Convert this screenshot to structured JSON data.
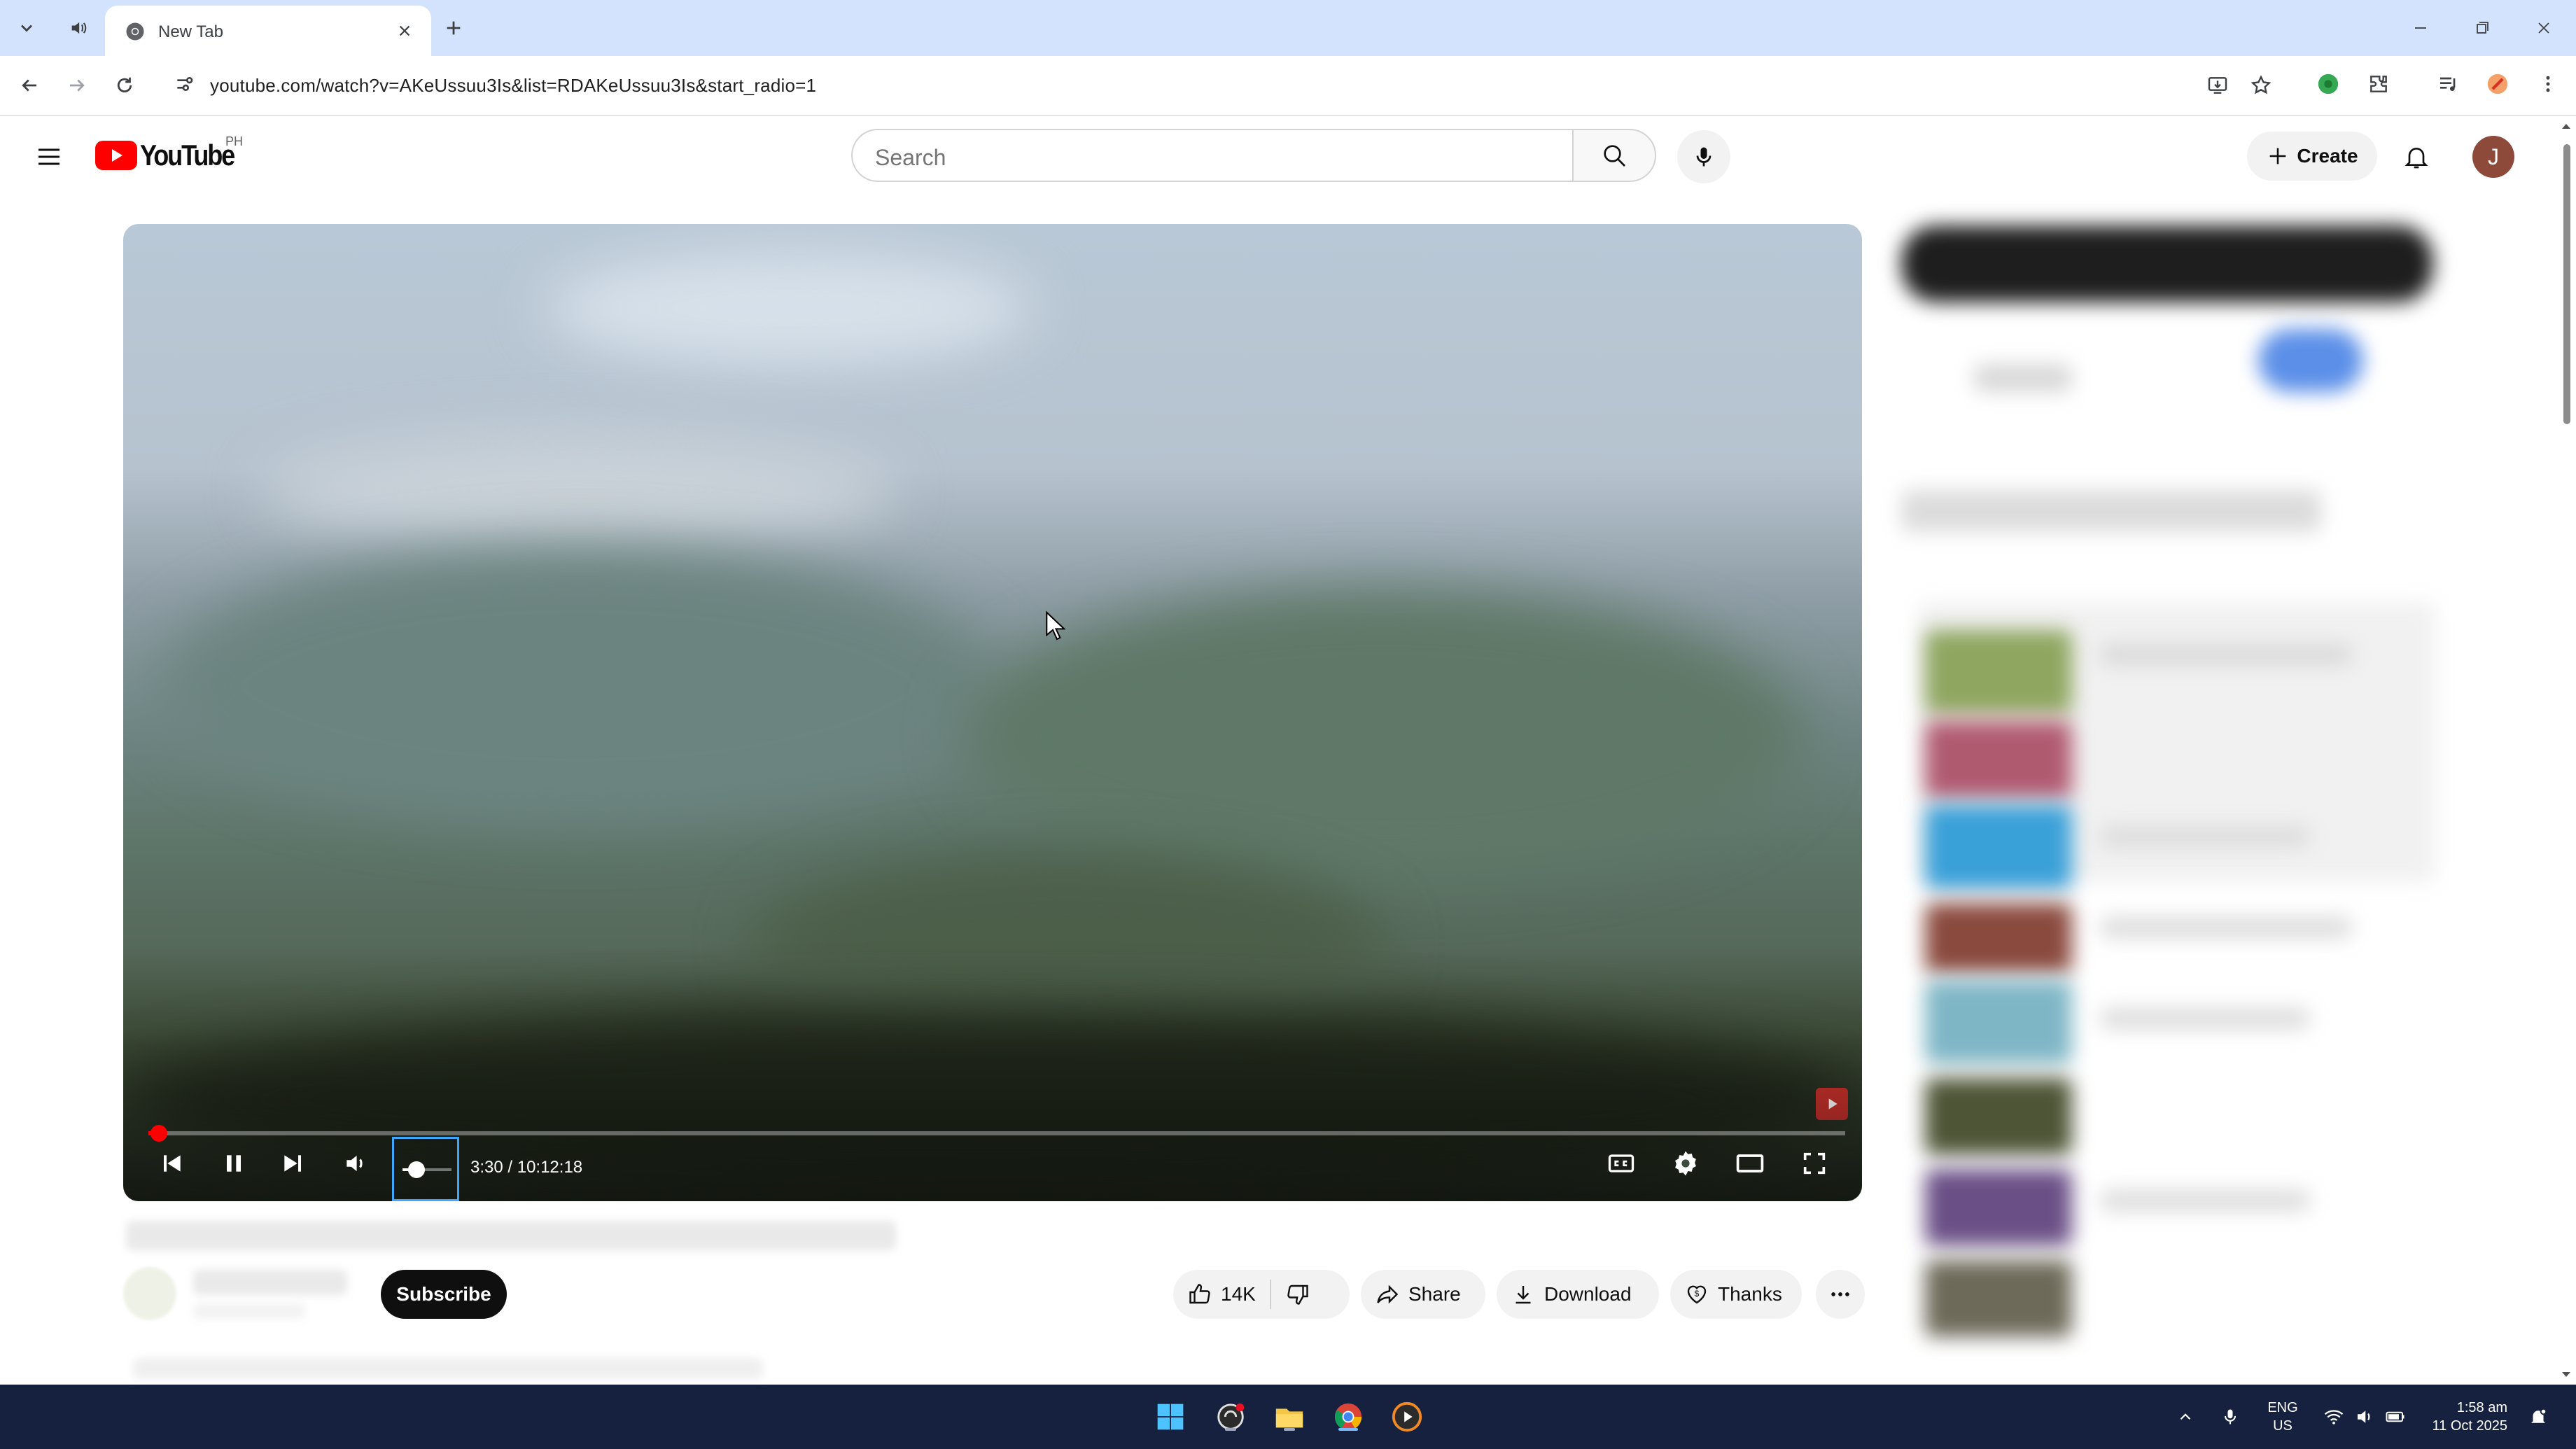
{
  "browser": {
    "tab": {
      "title": "New Tab",
      "icon": "chrome-icon"
    },
    "url": "youtube.com/watch?v=AKeUssuu3Is&list=RDAKeUssuu3Is&start_radio=1",
    "icons": [
      "tab-list-icon",
      "speaker-icon",
      "back-icon",
      "forward-icon",
      "reload-icon",
      "site-info-icon",
      "install-icon",
      "star-icon",
      "extension-green-icon",
      "puzzle-icon",
      "media-control-icon",
      "profile-extension-icon",
      "kebab-menu-icon"
    ]
  },
  "youtube": {
    "logo_text": "YouTube",
    "country": "PH",
    "search": {
      "placeholder": "Search"
    },
    "create_label": "Create",
    "avatar_letter": "J"
  },
  "player": {
    "time": "3:30 / 10:12:18",
    "progress": 0.006,
    "volume": 0.28,
    "watermark_color": "#c4302b"
  },
  "actions": {
    "subscribe_label": "Subscribe",
    "like_count": "14K",
    "share_label": "Share",
    "download_label": "Download",
    "thanks_label": "Thanks"
  },
  "taskbar": {
    "lang_top": "ENG",
    "lang_bottom": "US",
    "time": "1:58 am",
    "date": "11 Oct 2025"
  },
  "colors": {
    "accent_red": "#ff0000",
    "chrome_blue": "#d3e3fd",
    "taskbar": "#16213f",
    "focus_blue": "#3ea6ff"
  }
}
